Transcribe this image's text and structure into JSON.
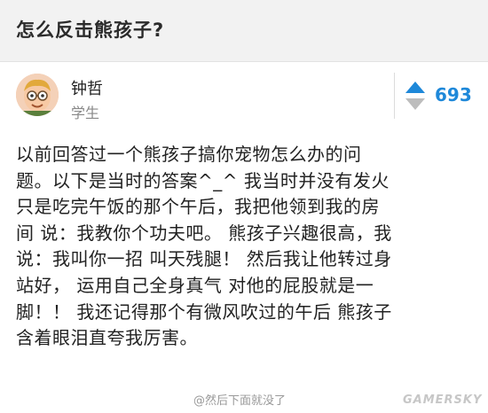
{
  "question": {
    "title": "怎么反击熊孩子?"
  },
  "author": {
    "name": "钟哲",
    "role": "学生"
  },
  "vote": {
    "count": "693"
  },
  "answer": {
    "lines": [
      "以前回答过一个熊孩子搞你宠物怎么办的问",
      "题。以下是当时的答案^_^ 我当时并没有发火",
      "只是吃完午饭的那个午后，我把他领到我的房",
      "间 说：我教你个功夫吧。 熊孩子兴趣很高，我",
      "说：我叫你一招 叫天残腿！ 然后我让他转过身",
      "站好， 运用自己全身真气 对他的屁股就是一",
      "脚！！ 我还记得那个有微风吹过的午后 熊孩子",
      "含着眼泪直夸我厉害。"
    ]
  },
  "footer": {
    "note": "@然后下面就没了",
    "watermark": "GAMERSKY"
  },
  "colors": {
    "accent": "#1e88d9",
    "header_bg": "#f2f2f2"
  }
}
